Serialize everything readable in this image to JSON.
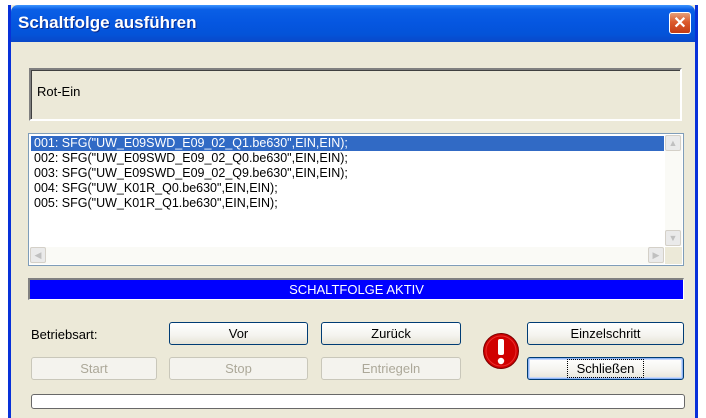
{
  "window": {
    "title": "Schaltfolge ausführen",
    "close_label": "✕"
  },
  "info": {
    "text": "Rot-Ein"
  },
  "list": {
    "items": [
      "001: SFG(\"UW_E09SWD_E09_02_Q1.be630\",EIN,EIN);",
      "002: SFG(\"UW_E09SWD_E09_02_Q0.be630\",EIN,EIN);",
      "003: SFG(\"UW_E09SWD_E09_02_Q9.be630\",EIN,EIN);",
      "004: SFG(\"UW_K01R_Q0.be630\",EIN,EIN);",
      "005: SFG(\"UW_K01R_Q1.be630\",EIN,EIN);"
    ],
    "selected_index": 0
  },
  "status": {
    "text": "SCHALTFOLGE AKTIV",
    "color": "#0000ff"
  },
  "controls": {
    "betriebsart_label": "Betriebsart:",
    "vor": "Vor",
    "zurueck": "Zurück",
    "einzelschritt": "Einzelschritt",
    "start": "Start",
    "stop": "Stop",
    "entriegeln": "Entriegeln",
    "schliessen": "Schließen"
  },
  "icons": {
    "warning": "exclamation-warning-icon",
    "close": "close-icon"
  },
  "progress": {
    "value": 0
  }
}
